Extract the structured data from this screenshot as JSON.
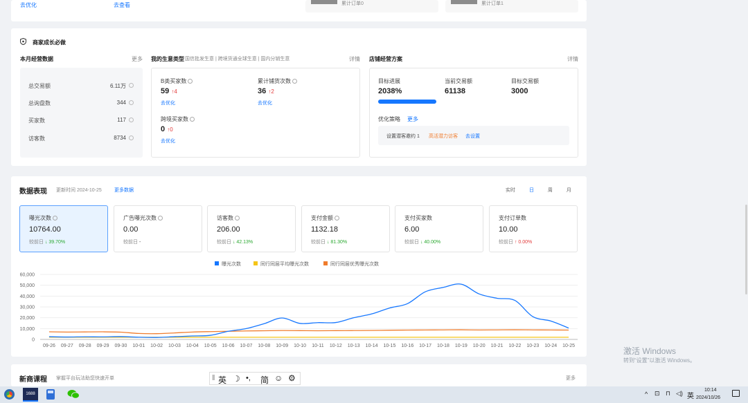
{
  "top": {
    "link_optimize": "去优化",
    "link_view": "去查看",
    "order_cnt_a": "累计订单0",
    "order_cnt_b": "累计订单1"
  },
  "growth": {
    "title": "商家成长必做",
    "monthly": {
      "title": "本月经营数据",
      "more": "更多",
      "rows": [
        {
          "label": "总交易额",
          "value": "6.11万"
        },
        {
          "label": "总询盘数",
          "value": "344"
        },
        {
          "label": "买家数",
          "value": "117"
        },
        {
          "label": "访客数",
          "value": "8734"
        }
      ]
    },
    "biz": {
      "title": "我的生意类型",
      "subtitle": "国信批发生意 | 跨境货通全球生意 | 国内分销生意",
      "detail": "详情",
      "items": [
        {
          "label": "B类买家数",
          "value": "59",
          "change": "4",
          "action": "去优化"
        },
        {
          "label": "累计铺货次数",
          "value": "36",
          "change": "2",
          "action": "去优化"
        },
        {
          "label": "跨境买家数",
          "value": "0",
          "change": "0",
          "action": "去优化"
        }
      ]
    },
    "plan": {
      "title": "店铺经营方案",
      "detail": "详情",
      "progress_label": "目标进展",
      "progress_value": "2038%",
      "progress_fill": 1.0,
      "current_label": "当前交易额",
      "current_value": "61138",
      "target_label": "目标交易额",
      "target_value": "3000",
      "strategy_label": "优化策略",
      "strategy_more": "更多",
      "task_label": "设置潜客邀约 1",
      "task_tag": "高活潜力访客",
      "task_action": "去设置"
    }
  },
  "perf": {
    "title": "数据表现",
    "updated": "更新时间 2024-10-25",
    "more": "更多数据",
    "tabs": [
      "实时",
      "日",
      "周",
      "月"
    ],
    "active_tab": "日",
    "metrics": [
      {
        "name": "曝光次数",
        "value": "10764.00",
        "cmp_label": "较前日",
        "cmp": "↓ 39.70%",
        "dir": "down"
      },
      {
        "name": "广告曝光次数",
        "value": "0.00",
        "cmp_label": "较前日",
        "cmp": "-",
        "dir": "none"
      },
      {
        "name": "访客数",
        "value": "206.00",
        "cmp_label": "较前日",
        "cmp": "↓ 42.13%",
        "dir": "down"
      },
      {
        "name": "支付金额",
        "value": "1132.18",
        "cmp_label": "较前日",
        "cmp": "↓ 81.30%",
        "dir": "down"
      },
      {
        "name": "支付买家数",
        "value": "6.00",
        "cmp_label": "较前日",
        "cmp": "↓ 40.00%",
        "dir": "down"
      },
      {
        "name": "支付订单数",
        "value": "10.00",
        "cmp_label": "较前日",
        "cmp": "↑ 0.00%",
        "dir": "up"
      }
    ]
  },
  "chart_data": {
    "type": "line",
    "x": [
      "09-26",
      "09-27",
      "09-28",
      "09-29",
      "09-30",
      "10-01",
      "10-02",
      "10-03",
      "10-04",
      "10-05",
      "10-06",
      "10-07",
      "10-08",
      "10-09",
      "10-10",
      "10-11",
      "10-12",
      "10-13",
      "10-14",
      "10-15",
      "10-16",
      "10-17",
      "10-18",
      "10-19",
      "10-20",
      "10-21",
      "10-22",
      "10-23",
      "10-24",
      "10-25"
    ],
    "yticks": [
      "0",
      "10,000",
      "20,000",
      "30,000",
      "40,000",
      "50,000",
      "60,000"
    ],
    "ylim": [
      0,
      60000
    ],
    "grid": true,
    "legend_position": "top",
    "series": [
      {
        "name": "曝光次数",
        "color": "#1677ff",
        "values": [
          2500,
          2200,
          2400,
          2300,
          2600,
          2000,
          1800,
          2500,
          3200,
          3800,
          7500,
          10000,
          14500,
          19800,
          14800,
          15500,
          15600,
          20000,
          23500,
          29000,
          33000,
          44000,
          48000,
          51000,
          42000,
          38000,
          36000,
          21000,
          17000,
          10500
        ]
      },
      {
        "name": "同行同层平均曝光次数",
        "color": "#f5c518",
        "values": [
          2000,
          2000,
          2000,
          2000,
          2000,
          2000,
          2000,
          2000,
          2000,
          2000,
          2000,
          2000,
          2000,
          2000,
          2000,
          2000,
          2000,
          2000,
          2000,
          2000,
          2000,
          2000,
          2000,
          2000,
          2000,
          2000,
          2000,
          2000,
          2000,
          2000
        ]
      },
      {
        "name": "同行同层优秀曝光次数",
        "color": "#f07c2c",
        "values": [
          7000,
          6800,
          6900,
          7000,
          6700,
          5500,
          5300,
          6000,
          6800,
          7200,
          7500,
          7800,
          8000,
          8200,
          8100,
          8000,
          8100,
          8200,
          8300,
          8500,
          8600,
          8700,
          8800,
          8900,
          8700,
          8800,
          8900,
          8800,
          8700,
          8600
        ]
      }
    ]
  },
  "course": {
    "title": "新商课程",
    "subtitle": "掌握平台玩法助您快速开单",
    "more": "更多"
  },
  "ime": {
    "lang": "英",
    "punct": "•,",
    "simp": "简"
  },
  "watermark": {
    "line1": "激活 Windows",
    "line2": "转到“设置”以激活 Windows。"
  },
  "taskbar": {
    "app_badge": "1688",
    "lang": "英",
    "time": "10:14",
    "date": "2024/10/26"
  }
}
